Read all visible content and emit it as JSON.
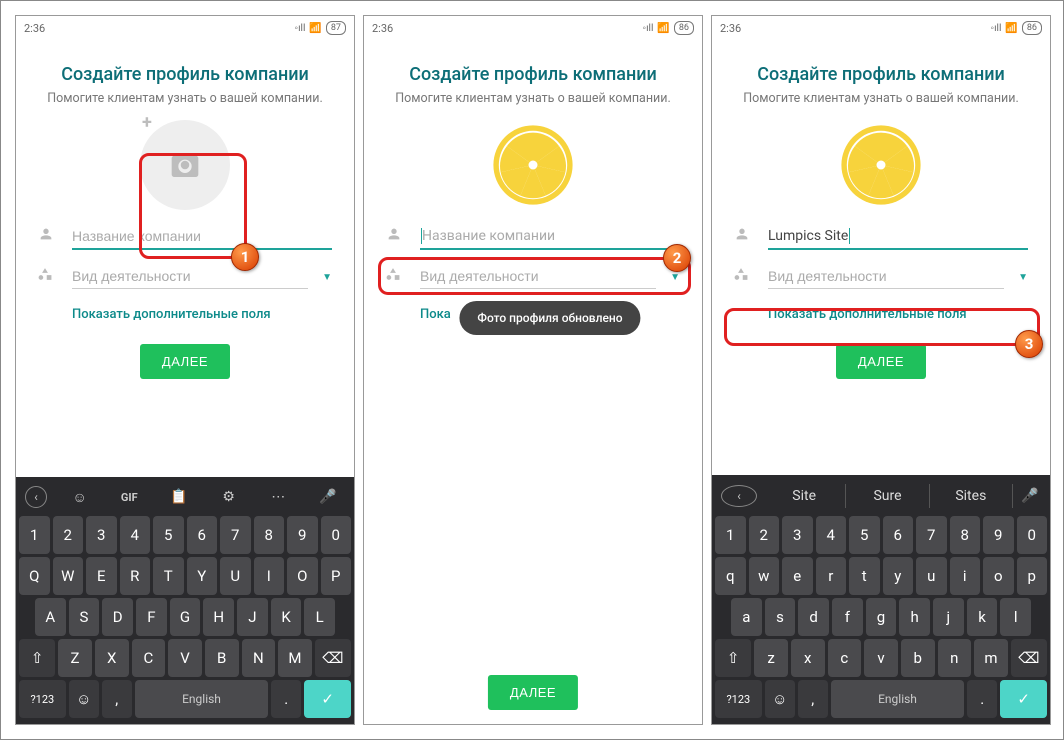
{
  "status": {
    "time": "2:36",
    "battery1": "87",
    "battery2": "86",
    "battery3": "86"
  },
  "screen": {
    "title": "Создайте профиль компании",
    "subtitle": "Помогите клиентам узнать о вашей компании.",
    "company_placeholder": "Название компании",
    "company_value": "Lumpics Site",
    "activity_placeholder": "Вид деятельности",
    "show_more": "Показать дополнительные поля",
    "show_more_short": "Пока",
    "next": "ДАЛЕЕ",
    "toast": "Фото профиля обновлено"
  },
  "keyboard": {
    "row_num": [
      "1",
      "2",
      "3",
      "4",
      "5",
      "6",
      "7",
      "8",
      "9",
      "0"
    ],
    "row1_upper": [
      "Q",
      "W",
      "E",
      "R",
      "T",
      "Y",
      "U",
      "I",
      "O",
      "P"
    ],
    "row2_upper": [
      "A",
      "S",
      "D",
      "F",
      "G",
      "H",
      "J",
      "K",
      "L"
    ],
    "row3_upper": [
      "Z",
      "X",
      "C",
      "V",
      "B",
      "N",
      "M"
    ],
    "row1_lower": [
      "q",
      "w",
      "e",
      "r",
      "t",
      "y",
      "u",
      "i",
      "o",
      "p"
    ],
    "row2_lower": [
      "a",
      "s",
      "d",
      "f",
      "g",
      "h",
      "j",
      "k",
      "l"
    ],
    "row3_lower": [
      "z",
      "x",
      "c",
      "v",
      "b",
      "n",
      "m"
    ],
    "sym": "?123",
    "gif": "GIF",
    "lang": "English",
    "suggestions": [
      "Site",
      "Sure",
      "Sites"
    ]
  },
  "badges": {
    "b1": "1",
    "b2": "2",
    "b3": "3"
  }
}
